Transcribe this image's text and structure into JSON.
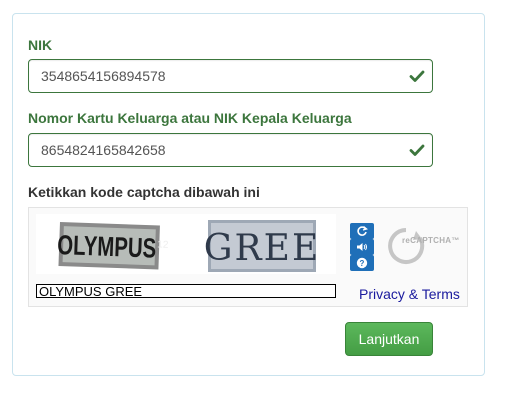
{
  "form": {
    "nik_label": "NIK",
    "nik_value": "3548654156894578",
    "kk_label": "Nomor Kartu Keluarga atau NIK Kepala Keluarga",
    "kk_value": "8654824165842658",
    "captcha_label": "Ketikkan kode captcha dibawah ini",
    "submit_label": "Lanjutkan"
  },
  "captcha": {
    "word1": "OLYMPUS",
    "word2": "GREE",
    "response_value": "OLYMPUS GREE",
    "privacy_link": "Privacy & Terms",
    "logo_text": "reCAPTCHA™",
    "controls": [
      "refresh-icon",
      "audio-icon",
      "help-icon"
    ]
  },
  "colors": {
    "success": "#3c763d",
    "button": "#5cb85c",
    "recaptcha_blue": "#1f6fb8",
    "link": "#1a1a9e"
  }
}
